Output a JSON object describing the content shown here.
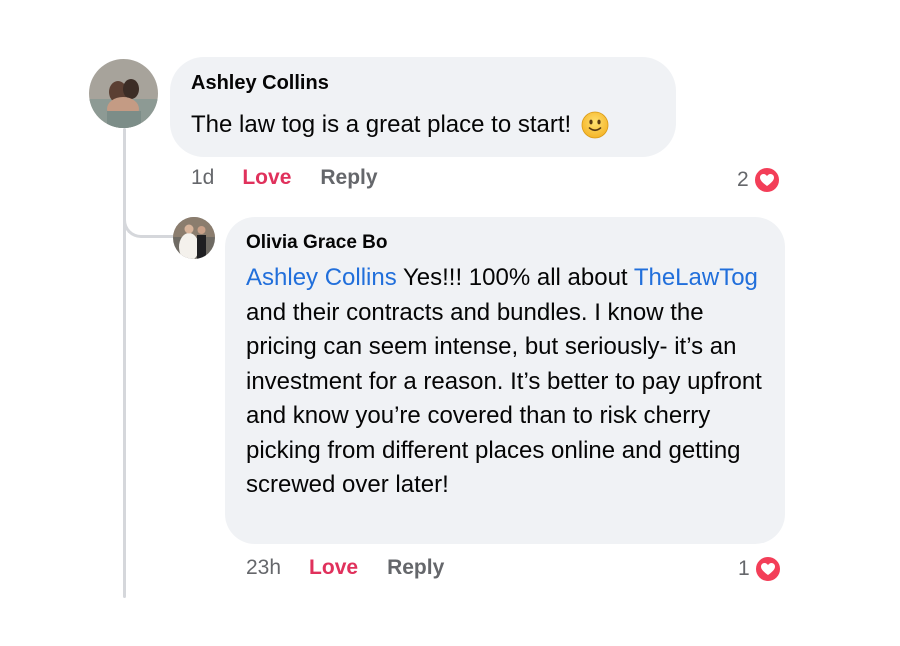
{
  "comments": [
    {
      "author": "Ashley Collins",
      "text": "The law tog is a great place to start!",
      "emoji": "slightly-smiling-face-icon",
      "time": "1d",
      "love_label": "Love",
      "reply_label": "Reply",
      "reaction_count": "2",
      "reaction_icon": "heart-icon"
    },
    {
      "author": "Olivia Grace Bo",
      "mention": "Ashley Collins",
      "text_after_mention": " Yes!!! 100% all about ",
      "page_mention": "TheLawTog",
      "text_rest": " and their contracts and bundles. I know the pricing can seem intense, but seriously- it’s an investment for a reason. It’s better to pay upfront and know you’re covered than to risk cherry picking from different places online and getting screwed over later!",
      "time": "23h",
      "love_label": "Love",
      "reply_label": "Reply",
      "reaction_count": "1",
      "reaction_icon": "heart-icon"
    }
  ],
  "colors": {
    "bubble": "#f0f2f5",
    "mention": "#216fdb",
    "love": "#e0315c",
    "meta": "#65676b",
    "heart_badge": "#f33e58"
  }
}
